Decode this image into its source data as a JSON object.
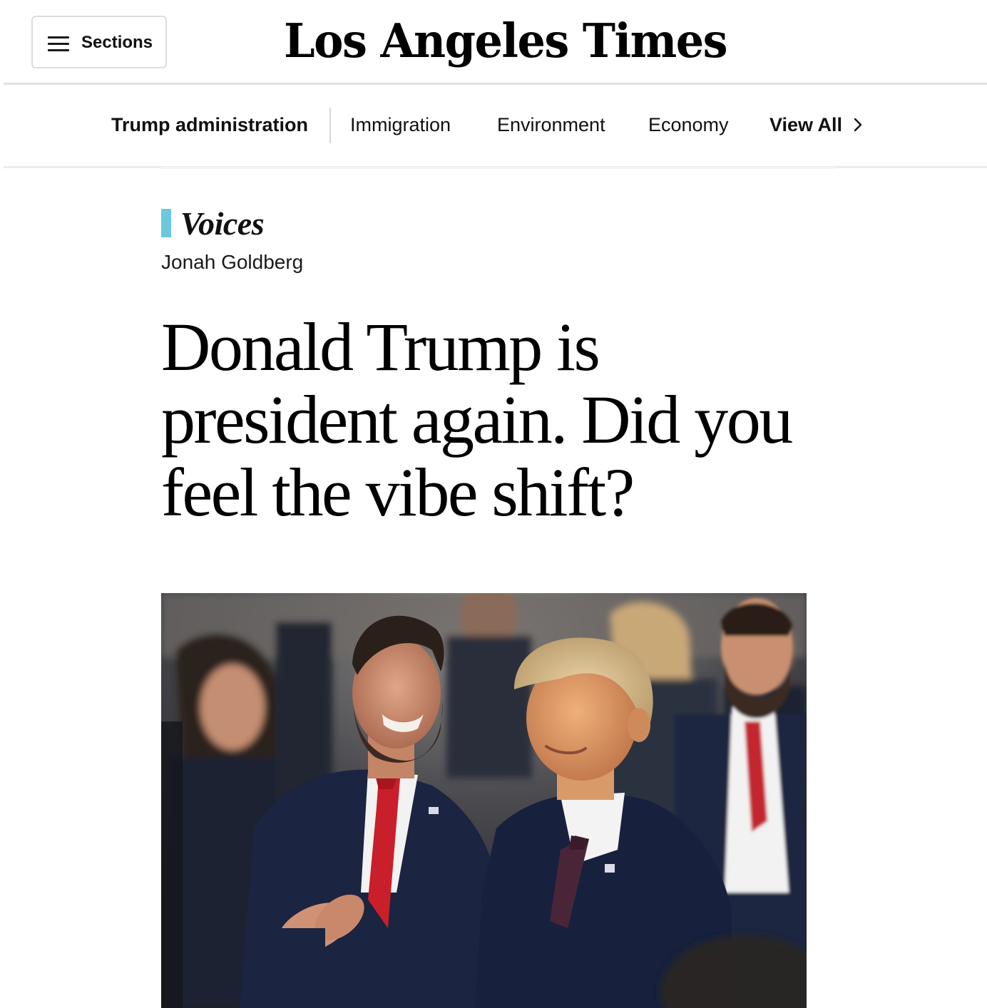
{
  "header": {
    "sections_label": "Sections",
    "logo_text": "Los Angeles Times"
  },
  "nav": {
    "items": [
      {
        "label": "Trump administration",
        "bold": true
      },
      {
        "label": "Immigration",
        "bold": false
      },
      {
        "label": "Environment",
        "bold": false
      },
      {
        "label": "Economy",
        "bold": false
      },
      {
        "label": "View All",
        "bold": true
      }
    ]
  },
  "article": {
    "section_label": "Voices",
    "byline": "Jonah Goldberg",
    "headline": "Donald Trump is president again. Did you feel the vibe shift?"
  },
  "colors": {
    "voices_accent": "#6cc9dc",
    "rule": "#e2e2e2",
    "text": "#111111"
  },
  "icons": {
    "sections": "hamburger-icon",
    "view_all": "chevron-right-icon"
  }
}
